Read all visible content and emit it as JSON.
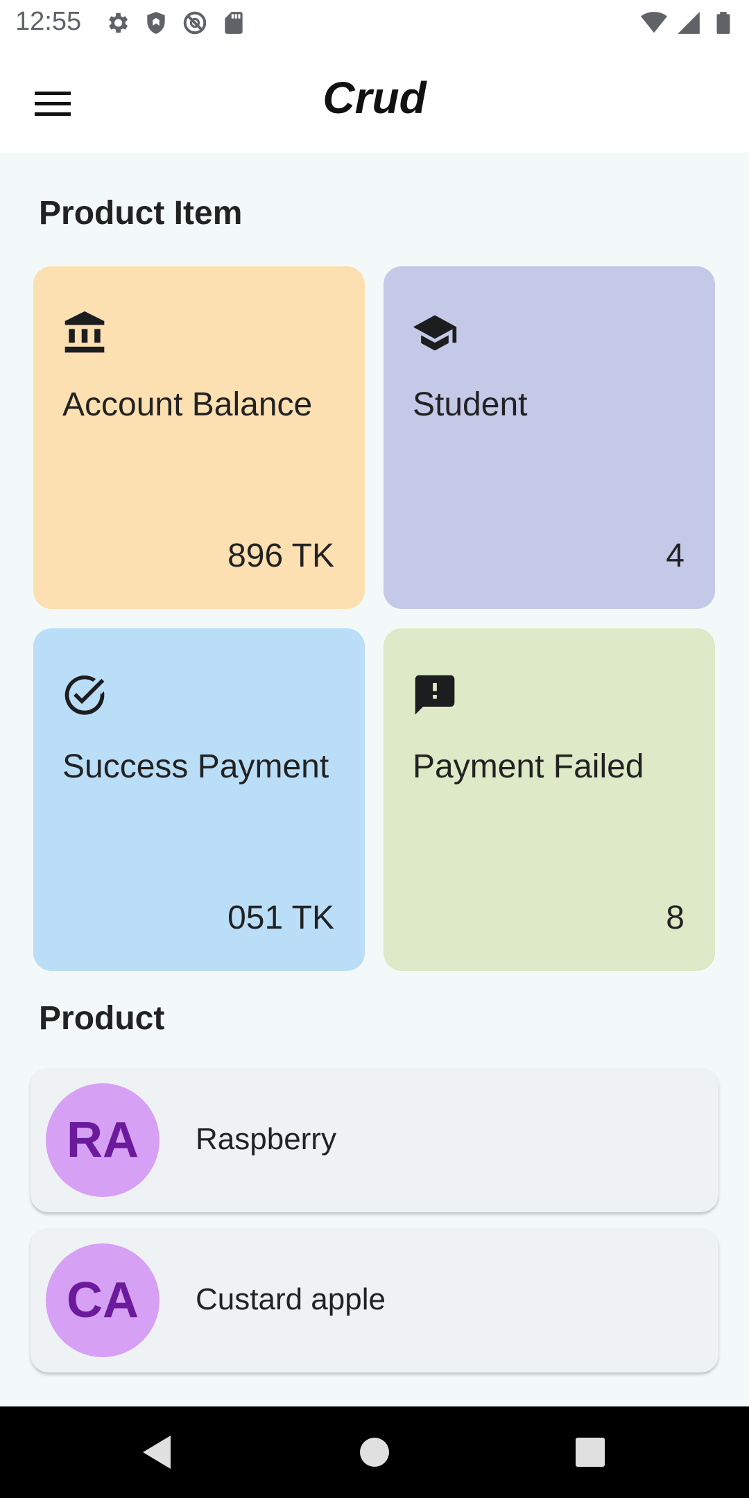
{
  "status_bar": {
    "time": "12:55",
    "left_icons": [
      "settings-icon",
      "shield-icon",
      "no-sync-icon",
      "sd-card-icon"
    ],
    "right_icons": [
      "wifi-icon",
      "signal-icon",
      "battery-icon"
    ]
  },
  "app_bar": {
    "title": "Crud",
    "menu_icon": "hamburger-menu-icon"
  },
  "product_item_section": {
    "title": "Product Item",
    "cards": [
      {
        "label": "Account Balance",
        "value": "896 TK",
        "icon": "bank-icon",
        "color": "#fde0b2"
      },
      {
        "label": "Student",
        "value": "4",
        "icon": "graduation-cap-icon",
        "color": "#c5c9e8"
      },
      {
        "label": "Success Payment",
        "value": "051 TK",
        "icon": "check-circle-icon",
        "color": "#bbdef8"
      },
      {
        "label": "Payment Failed",
        "value": "8",
        "icon": "feedback-alert-icon",
        "color": "#dde9c7"
      }
    ]
  },
  "product_section": {
    "title": "Product",
    "items": [
      {
        "initials": "RA",
        "name": "Raspberry"
      },
      {
        "initials": "CA",
        "name": "Custard apple"
      }
    ]
  },
  "nav_bar": {
    "buttons": [
      "back-icon",
      "home-icon",
      "recents-icon"
    ]
  },
  "colors": {
    "background": "#f3f9f9",
    "avatar_bg": "#d6a0f4",
    "avatar_text": "#6a1a9a"
  }
}
